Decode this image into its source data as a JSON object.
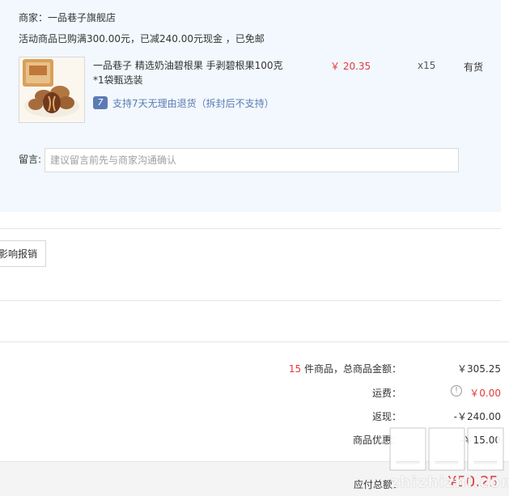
{
  "seller": {
    "name": "商家：一品巷子旗舰店",
    "promo": "活动商品已购满300.00元，已减240.00元现金 ，已免邮"
  },
  "item": {
    "title": "一品巷子 精选奶油碧根果 手剥碧根果100克",
    "variant": "*1袋甄选装",
    "price": "￥ 20.35",
    "quantity": "x15",
    "stock": "有货",
    "service_icon": "7",
    "service": "支持7天无理由退货（拆封后不支持）",
    "image_icon": "pecan-product-image"
  },
  "note": {
    "label": "留言:",
    "placeholder": "建议留言前先与商家沟通确认"
  },
  "invoice": {
    "button_label": "影响报销"
  },
  "summary": {
    "count": "15",
    "count_suffix": " 件商品，总商品金额：",
    "total_value": "￥305.25",
    "freight_label": "运费：",
    "freight_value": "￥0.00",
    "rebate_label": "返现：",
    "rebate_value": "-￥240.00",
    "discount_label": "商品优惠：",
    "discount_value": "-￥15.00",
    "payable_label": "应付总额：",
    "payable_value": "¥50.25"
  },
  "watermark": {
    "site": "zhizhizhi.com"
  },
  "colors": {
    "accent_red": "#e4393c",
    "panel_bg": "#f2f8fd",
    "service_blue": "#5b7bb4"
  }
}
